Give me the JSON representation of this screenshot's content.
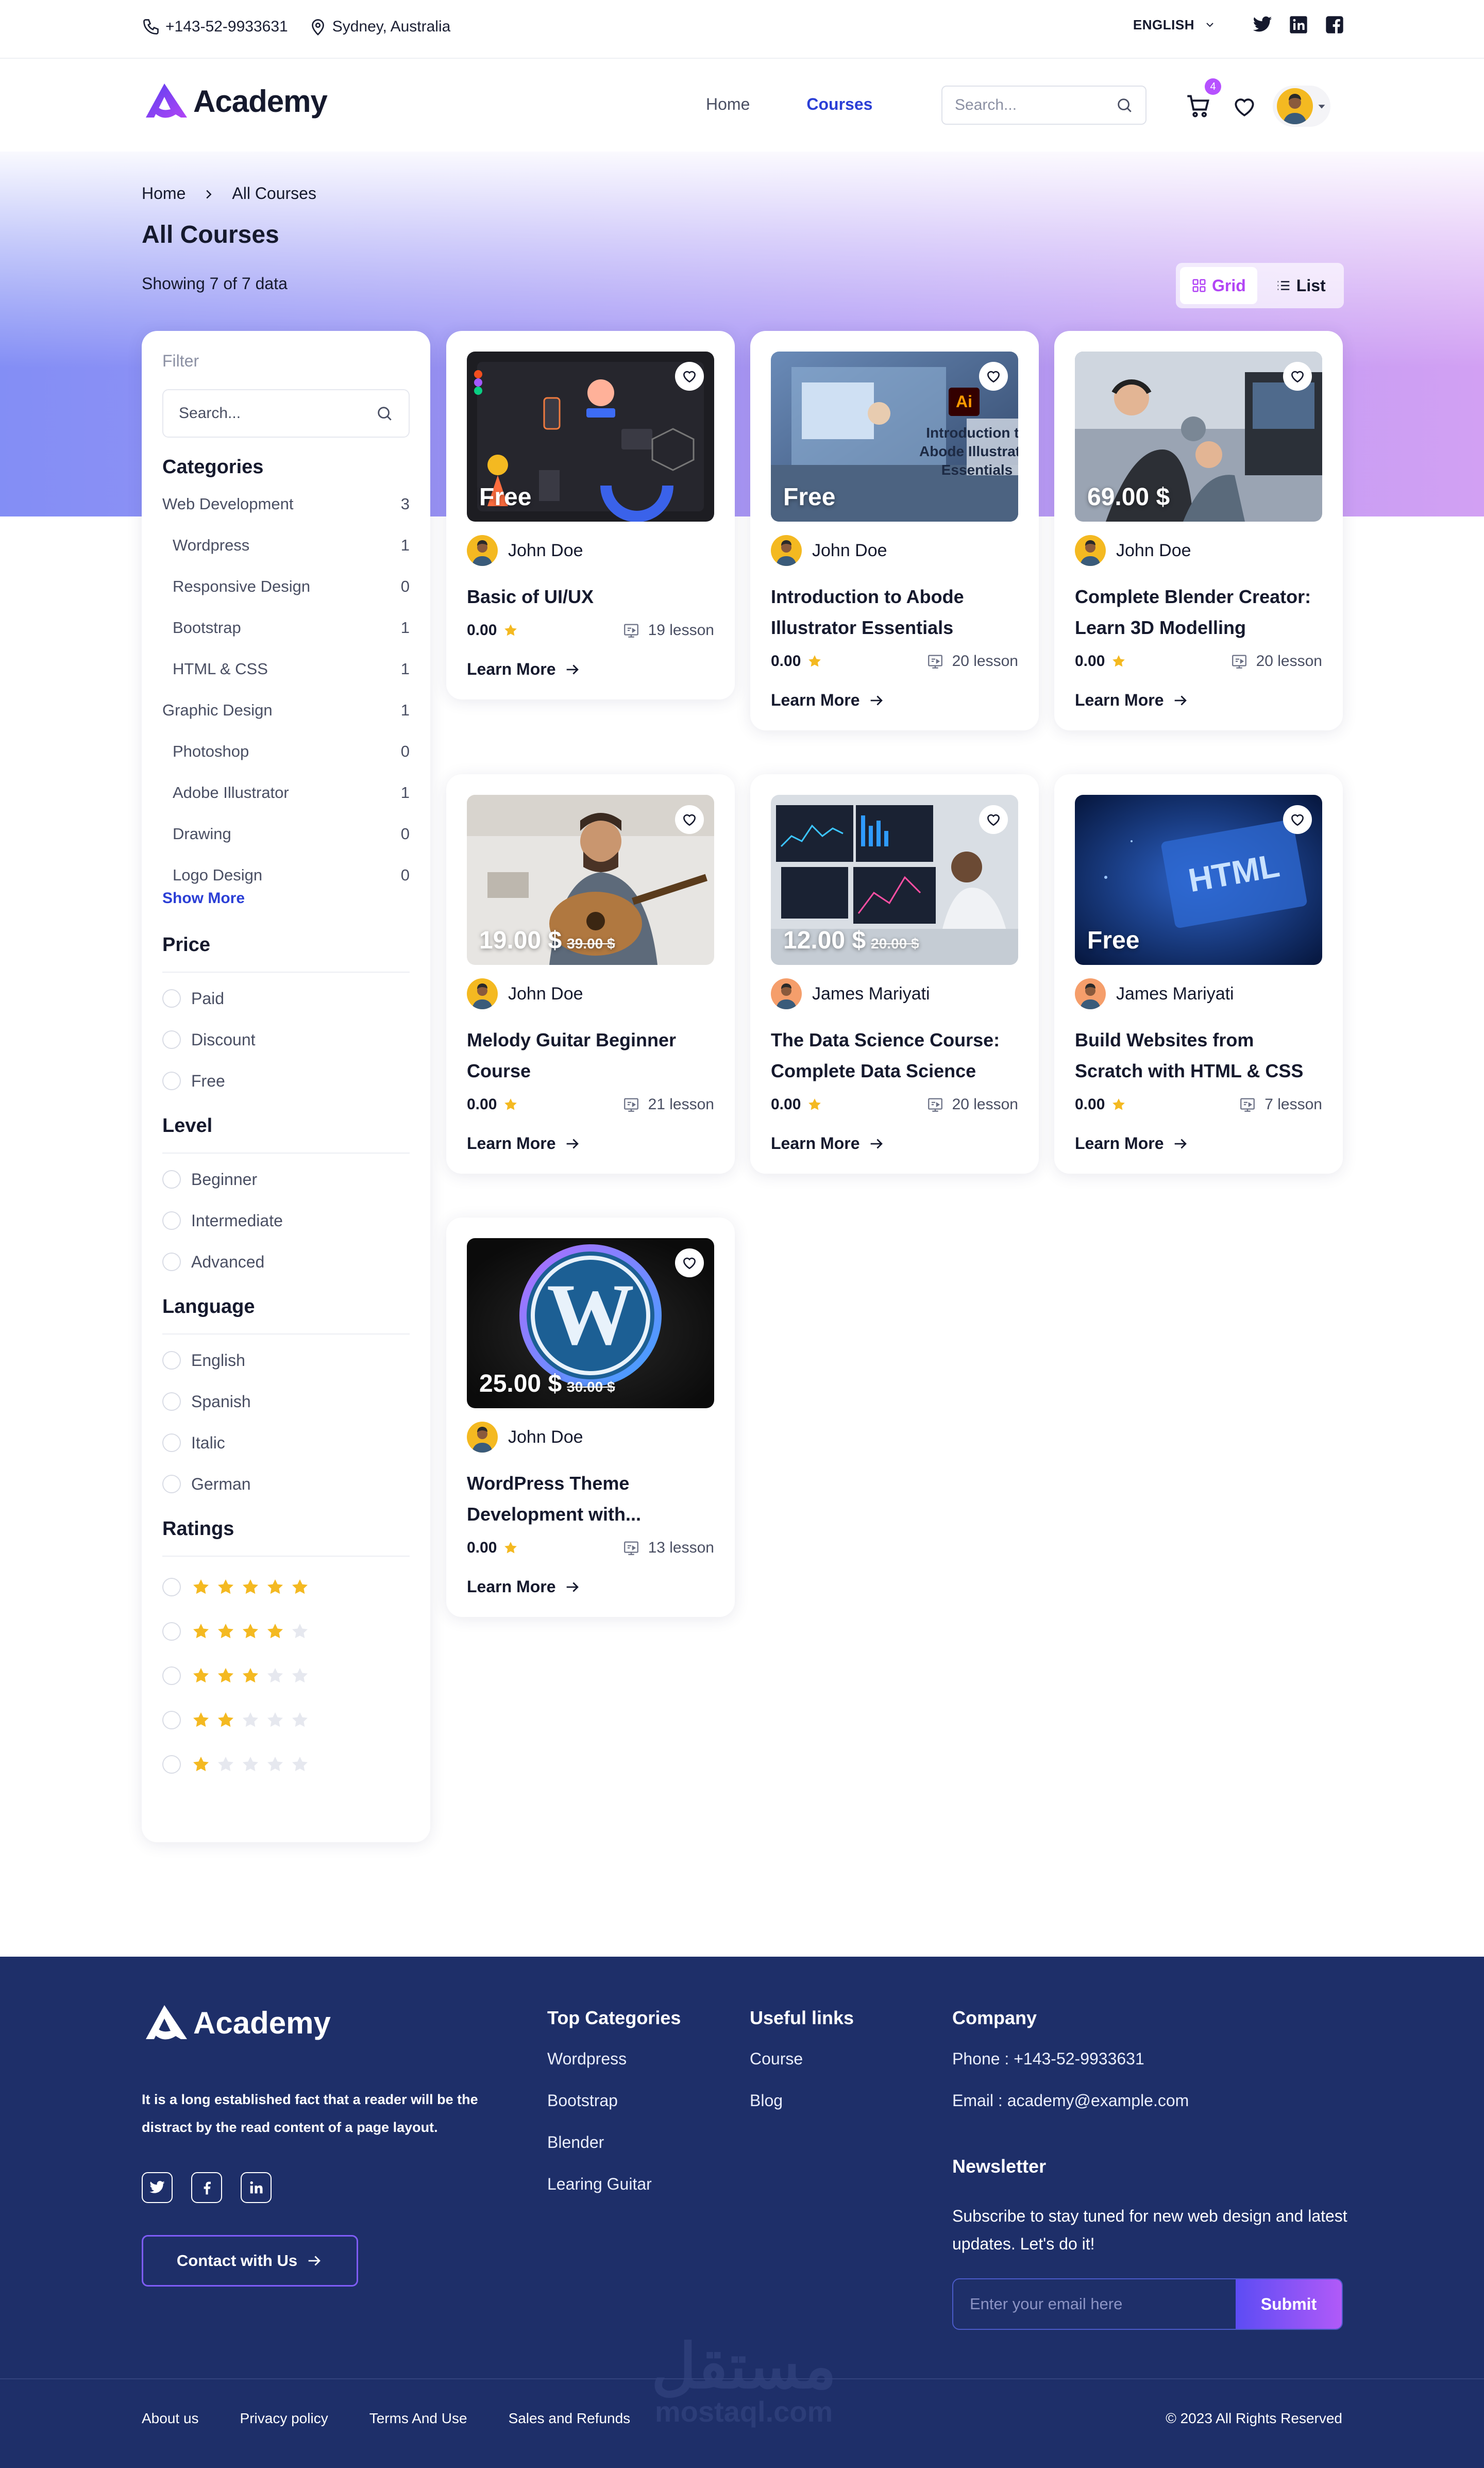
{
  "topbar": {
    "phone": "+143-52-9933631",
    "location": "Sydney, Australia",
    "language": "ENGLISH"
  },
  "header": {
    "logo": "Academy",
    "nav": {
      "home": "Home",
      "courses": "Courses"
    },
    "search_placeholder": "Search...",
    "cart_count": "4"
  },
  "page": {
    "breadcrumb": {
      "home": "Home",
      "current": "All Courses"
    },
    "title": "All Courses",
    "showing": "Showing 7 of 7 data",
    "view": {
      "grid": "Grid",
      "list": "List"
    }
  },
  "filter": {
    "label": "Filter",
    "search_placeholder": "Search...",
    "categories_title": "Categories",
    "categories": [
      {
        "name": "Web Development",
        "count": "3",
        "sub": false
      },
      {
        "name": "Wordpress",
        "count": "1",
        "sub": true
      },
      {
        "name": "Responsive Design",
        "count": "0",
        "sub": true
      },
      {
        "name": "Bootstrap",
        "count": "1",
        "sub": true
      },
      {
        "name": "HTML & CSS",
        "count": "1",
        "sub": true
      },
      {
        "name": "Graphic Design",
        "count": "1",
        "sub": false
      },
      {
        "name": "Photoshop",
        "count": "0",
        "sub": true
      },
      {
        "name": "Adobe Illustrator",
        "count": "1",
        "sub": true
      },
      {
        "name": "Drawing",
        "count": "0",
        "sub": true
      },
      {
        "name": "Logo Design",
        "count": "0",
        "sub": true
      }
    ],
    "show_more": "Show More",
    "price_title": "Price",
    "price": [
      "Paid",
      "Discount",
      "Free"
    ],
    "level_title": "Level",
    "level": [
      "Beginner",
      "Intermediate",
      "Advanced"
    ],
    "language_title": "Language",
    "languages": [
      "English",
      "Spanish",
      "Italic",
      "German"
    ],
    "ratings_title": "Ratings",
    "ratings": [
      5,
      4,
      3,
      2,
      1
    ]
  },
  "courses": [
    {
      "price": "Free",
      "old_price": "",
      "author": "John Doe",
      "title": "Basic of UI/UX",
      "rating": "0.00",
      "lessons": "19 lesson",
      "cta": "Learn More",
      "theme": "uiux",
      "avatar_color": "#f4b921"
    },
    {
      "price": "Free",
      "old_price": "",
      "author": "John Doe",
      "title": "Introduction to Abode Illustrator Essentials",
      "rating": "0.00",
      "lessons": "20 lesson",
      "cta": "Learn More",
      "theme": "illustrator",
      "avatar_color": "#f4b921",
      "thumb_text": "Introduction to Abode Illustrator Essentials",
      "thumb_badge": "Ai"
    },
    {
      "price": "69.00 $",
      "old_price": "",
      "author": "John Doe",
      "title": "Complete Blender Creator: Learn 3D Modelling",
      "rating": "0.00",
      "lessons": "20 lesson",
      "cta": "Learn More",
      "theme": "blender",
      "avatar_color": "#f4b921"
    },
    {
      "price": "19.00 $",
      "old_price": "39.00 $",
      "author": "John Doe",
      "title": "Melody Guitar Beginner Course",
      "rating": "0.00",
      "lessons": "21 lesson",
      "cta": "Learn More",
      "theme": "guitar",
      "avatar_color": "#f4b921"
    },
    {
      "price": "12.00 $",
      "old_price": "20.00 $",
      "author": "James Mariyati",
      "title": "The Data Science Course: Complete Data Science",
      "rating": "0.00",
      "lessons": "20 lesson",
      "cta": "Learn More",
      "theme": "data",
      "avatar_color": "#f59e6b"
    },
    {
      "price": "Free",
      "old_price": "",
      "author": "James Mariyati",
      "title": "Build Websites from Scratch with HTML & CSS",
      "rating": "0.00",
      "lessons": "7 lesson",
      "cta": "Learn More",
      "theme": "html",
      "avatar_color": "#f59e6b",
      "thumb_text": "HTML"
    },
    {
      "price": "25.00 $",
      "old_price": "30.00 $",
      "author": "John Doe",
      "title": "WordPress Theme Development with...",
      "rating": "0.00",
      "lessons": "13 lesson",
      "cta": "Learn More",
      "theme": "wordpress",
      "avatar_color": "#f4b921"
    }
  ],
  "footer": {
    "logo": "Academy",
    "description": "It is a long established fact that a reader will be the distract by the read content of a page layout.",
    "contact_button": "Contact with Us",
    "top_categories_title": "Top Categories",
    "top_categories": [
      "Wordpress",
      "Bootstrap",
      "Blender",
      "Learing Guitar"
    ],
    "useful_title": "Useful links",
    "useful": [
      "Course",
      "Blog"
    ],
    "company_title": "Company",
    "company": [
      "Phone : +143-52-9933631",
      "Email : academy@example.com"
    ],
    "newsletter_title": "Newsletter",
    "newsletter_text": "Subscribe to stay tuned for new web design and latest updates. Let's do it!",
    "email_placeholder": "Enter your email here",
    "submit": "Submit",
    "bottom_links": [
      "About us",
      "Privacy policy",
      "Terms And Use",
      "Sales and Refunds"
    ],
    "copyright": "© 2023 All Rights Reserved",
    "watermark_ar": "مستقل",
    "watermark_en": "mostaql.com"
  },
  "colors": {
    "accent": "#2b3fd6",
    "purple": "#b245f5",
    "star": "#f4b921",
    "footer": "#1e2f69"
  }
}
